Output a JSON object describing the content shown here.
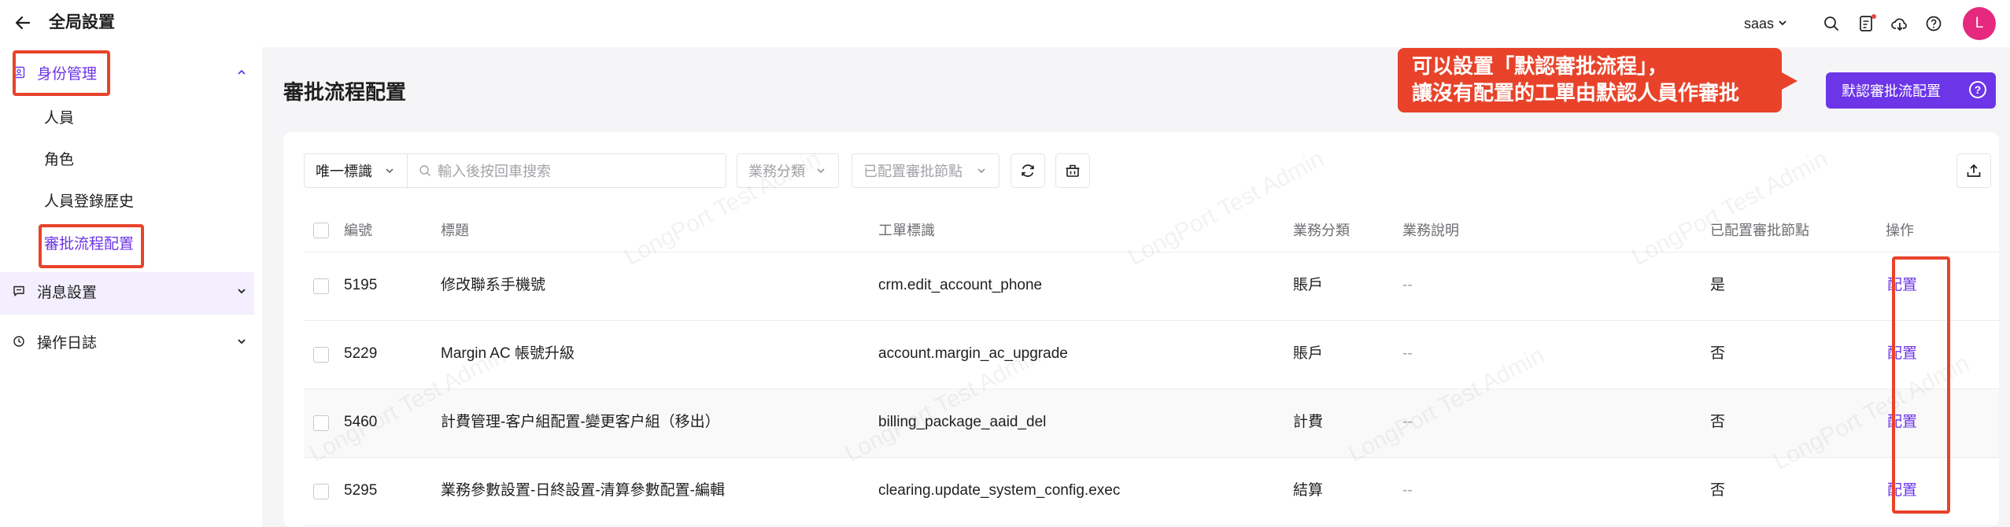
{
  "header": {
    "title": "全局設置",
    "tenant": "saas",
    "avatar_letter": "L"
  },
  "sidebar": {
    "groups": [
      {
        "label": "身份管理",
        "icon": "id-card-icon",
        "expanded": true,
        "items": [
          "人員",
          "角色",
          "人員登錄歷史",
          "審批流程配置"
        ]
      },
      {
        "label": "消息設置",
        "icon": "message-icon",
        "expanded": false
      },
      {
        "label": "操作日誌",
        "icon": "history-icon",
        "expanded": false
      }
    ],
    "active_item": "審批流程配置"
  },
  "page": {
    "title": "審批流程配置",
    "primary_button": "默認審批流配置",
    "callout": [
      "可以設置「默認審批流程」，",
      "讓沒有配置的工單由默認人員作審批"
    ]
  },
  "filters": {
    "id_type": "唯一標識",
    "search_placeholder": "輸入後按回車搜索",
    "category_placeholder": "業務分類",
    "node_placeholder": "已配置審批節點"
  },
  "table": {
    "columns": [
      "編號",
      "標題",
      "工單標識",
      "業務分類",
      "業務說明",
      "已配置審批節點",
      "操作"
    ],
    "rows": [
      {
        "id": "5195",
        "title": "修改聯系手機號",
        "key": "crm.edit_account_phone",
        "category": "賬戶",
        "desc": "--",
        "configured": "是",
        "action": "配置"
      },
      {
        "id": "5229",
        "title": "Margin AC 帳號升級",
        "key": "account.margin_ac_upgrade",
        "category": "賬戶",
        "desc": "--",
        "configured": "否",
        "action": "配置"
      },
      {
        "id": "5460",
        "title": "計費管理-客户組配置-變更客户組（移出）",
        "key": "billing_package_aaid_del",
        "category": "計費",
        "desc": "--",
        "configured": "否",
        "action": "配置"
      },
      {
        "id": "5295",
        "title": "業務參數設置-日終設置-清算參數配置-編輯",
        "key": "clearing.update_system_config.exec",
        "category": "結算",
        "desc": "--",
        "configured": "否",
        "action": "配置"
      }
    ]
  },
  "watermark": "LongPort Test Admin",
  "colors": {
    "accent": "#6c35e8",
    "annotation": "#e8432a",
    "avatar": "#e5297e"
  }
}
